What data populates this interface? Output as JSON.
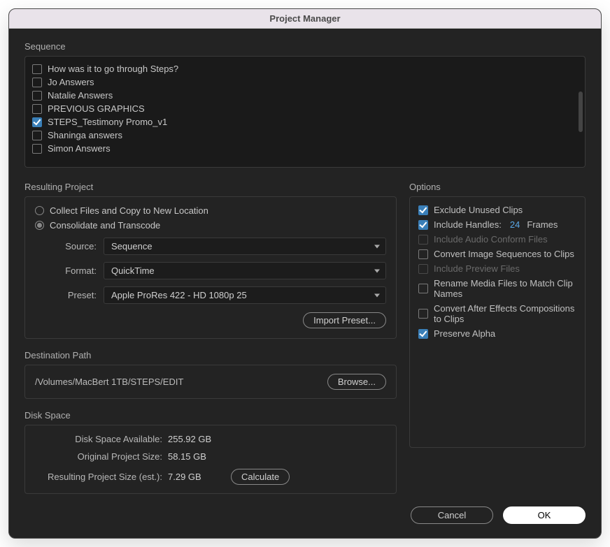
{
  "title": "Project Manager",
  "sequence": {
    "label": "Sequence",
    "items": [
      {
        "label": "How was it to go through Steps?",
        "checked": false
      },
      {
        "label": "Jo Answers",
        "checked": false
      },
      {
        "label": "Natalie Answers",
        "checked": false
      },
      {
        "label": "PREVIOUS GRAPHICS",
        "checked": false
      },
      {
        "label": "STEPS_Testimony Promo_v1",
        "checked": true
      },
      {
        "label": "Shaninga answers",
        "checked": false
      },
      {
        "label": "Simon Answers",
        "checked": false
      }
    ]
  },
  "resulting": {
    "label": "Resulting Project",
    "radios": {
      "collect": {
        "label": "Collect Files and Copy to New Location",
        "selected": false
      },
      "consolidate": {
        "label": "Consolidate and Transcode",
        "selected": true
      }
    },
    "source": {
      "label": "Source:",
      "value": "Sequence"
    },
    "format": {
      "label": "Format:",
      "value": "QuickTime"
    },
    "preset": {
      "label": "Preset:",
      "value": "Apple ProRes 422 - HD 1080p 25"
    },
    "import_preset": "Import Preset..."
  },
  "destination": {
    "label": "Destination Path",
    "path": "/Volumes/MacBert 1TB/STEPS/EDIT",
    "browse": "Browse..."
  },
  "disk": {
    "label": "Disk Space",
    "available": {
      "label": "Disk Space Available:",
      "value": "255.92 GB"
    },
    "original": {
      "label": "Original Project Size:",
      "value": "58.15 GB"
    },
    "resulting": {
      "label": "Resulting Project Size (est.):",
      "value": "7.29 GB"
    },
    "calculate": "Calculate"
  },
  "options": {
    "label": "Options",
    "exclude_unused": {
      "label": "Exclude Unused Clips",
      "checked": true,
      "disabled": false
    },
    "include_handles": {
      "label": "Include Handles:",
      "checked": true,
      "disabled": false,
      "value": "24",
      "suffix": "Frames"
    },
    "audio_conform": {
      "label": "Include Audio Conform Files",
      "checked": false,
      "disabled": true
    },
    "convert_img_seq": {
      "label": "Convert Image Sequences to Clips",
      "checked": false,
      "disabled": false
    },
    "preview_files": {
      "label": "Include Preview Files",
      "checked": false,
      "disabled": true
    },
    "rename_media": {
      "label": "Rename Media Files to Match Clip Names",
      "checked": false,
      "disabled": false
    },
    "convert_ae": {
      "label": "Convert After Effects Compositions to Clips",
      "checked": false,
      "disabled": false
    },
    "preserve_alpha": {
      "label": "Preserve Alpha",
      "checked": true,
      "disabled": false
    }
  },
  "footer": {
    "cancel": "Cancel",
    "ok": "OK"
  }
}
